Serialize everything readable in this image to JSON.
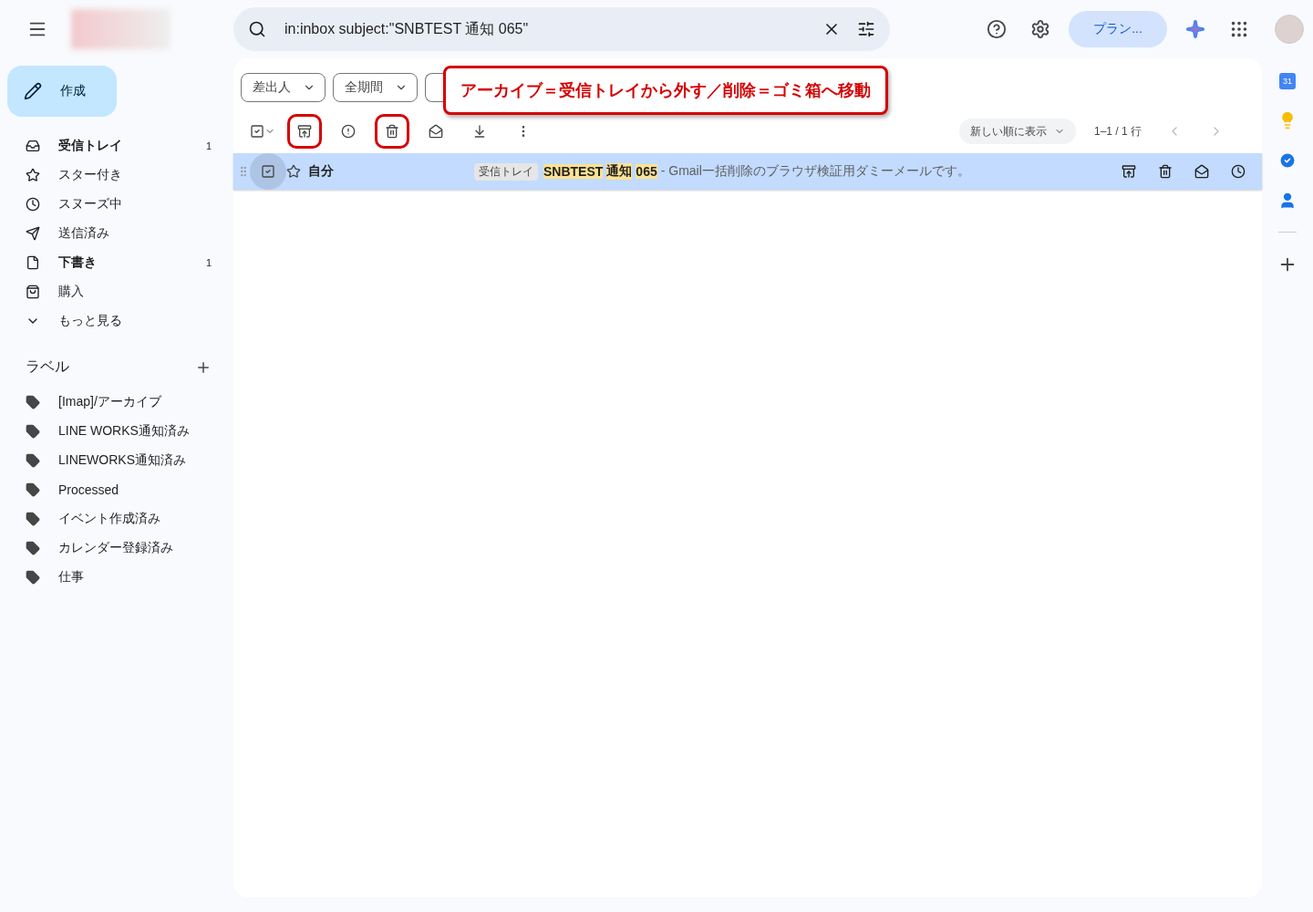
{
  "search": {
    "value": "in:inbox subject:\"SNBTEST 通知 065\""
  },
  "header": {
    "plan_button": "プラン..."
  },
  "compose": {
    "label": "作成"
  },
  "folders": [
    {
      "label": "受信トレイ",
      "count": "1",
      "bold": true
    },
    {
      "label": "スター付き",
      "bold": false
    },
    {
      "label": "スヌーズ中",
      "bold": false
    },
    {
      "label": "送信済み",
      "bold": false
    },
    {
      "label": "下書き",
      "count": "1",
      "bold": true
    },
    {
      "label": "購入",
      "bold": false
    },
    {
      "label": "もっと見る",
      "bold": false
    }
  ],
  "labels": {
    "title": "ラベル",
    "items": [
      "[Imap]/アーカイブ",
      "LINE WORKS通知済み",
      "LINEWORKS通知済み",
      "Processed",
      "イベント作成済み",
      "カレンダー登録済み",
      "仕事"
    ]
  },
  "filter_chips": [
    "差出人",
    "全期間"
  ],
  "toolbar": {
    "buttons": [
      {
        "circled": true
      },
      {
        "circled": false
      },
      {
        "circled": true
      },
      {
        "circled": false
      },
      {
        "circled": false
      },
      {
        "circled": false
      }
    ],
    "sort": "新しい順に表示",
    "range": "1–1 / 1 行"
  },
  "messages": [
    {
      "selected": true,
      "checked": true,
      "starred": false,
      "sender": "自分",
      "label": "受信トレイ",
      "subject_parts": [
        {
          "text": "SNBTEST",
          "highlighted": true
        },
        {
          "text": "通知",
          "highlighted": true
        },
        {
          "text": "065",
          "highlighted": true
        }
      ],
      "snippet": "- Gmail一括削除のブラウザ検証用ダミーメールです。"
    }
  ],
  "annotation": {
    "text": "アーカイブ＝受信トレイから外す／削除＝ゴミ箱へ移動"
  },
  "rail": {
    "calendar_day": "31"
  }
}
